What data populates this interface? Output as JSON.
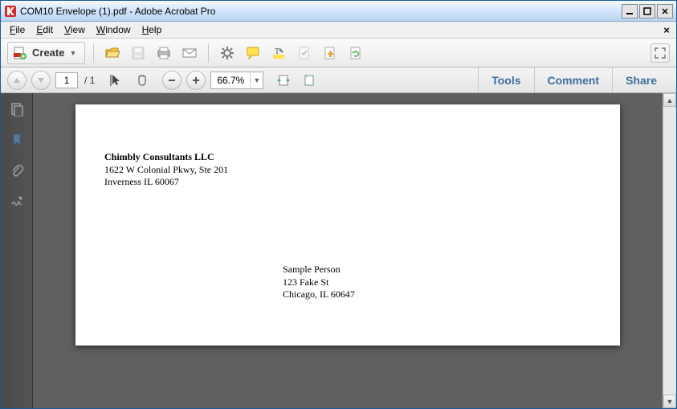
{
  "window": {
    "title": "COM10 Envelope (1).pdf - Adobe Acrobat Pro"
  },
  "menu": {
    "file": "File",
    "edit": "Edit",
    "view": "View",
    "window": "Window",
    "help": "Help"
  },
  "toolbar": {
    "create_label": "Create"
  },
  "nav": {
    "page_current": "1",
    "page_total": "/ 1",
    "zoom": "66.7%"
  },
  "panes": {
    "tools": "Tools",
    "comment": "Comment",
    "share": "Share"
  },
  "document": {
    "return_address": {
      "name": "Chimbly Consultants LLC",
      "line1": "1622 W Colonial Pkwy, Ste 201",
      "line2": "Inverness IL 60067"
    },
    "recipient_address": {
      "name": "Sample Person",
      "line1": "123 Fake St",
      "line2": "Chicago, IL 60647"
    }
  }
}
